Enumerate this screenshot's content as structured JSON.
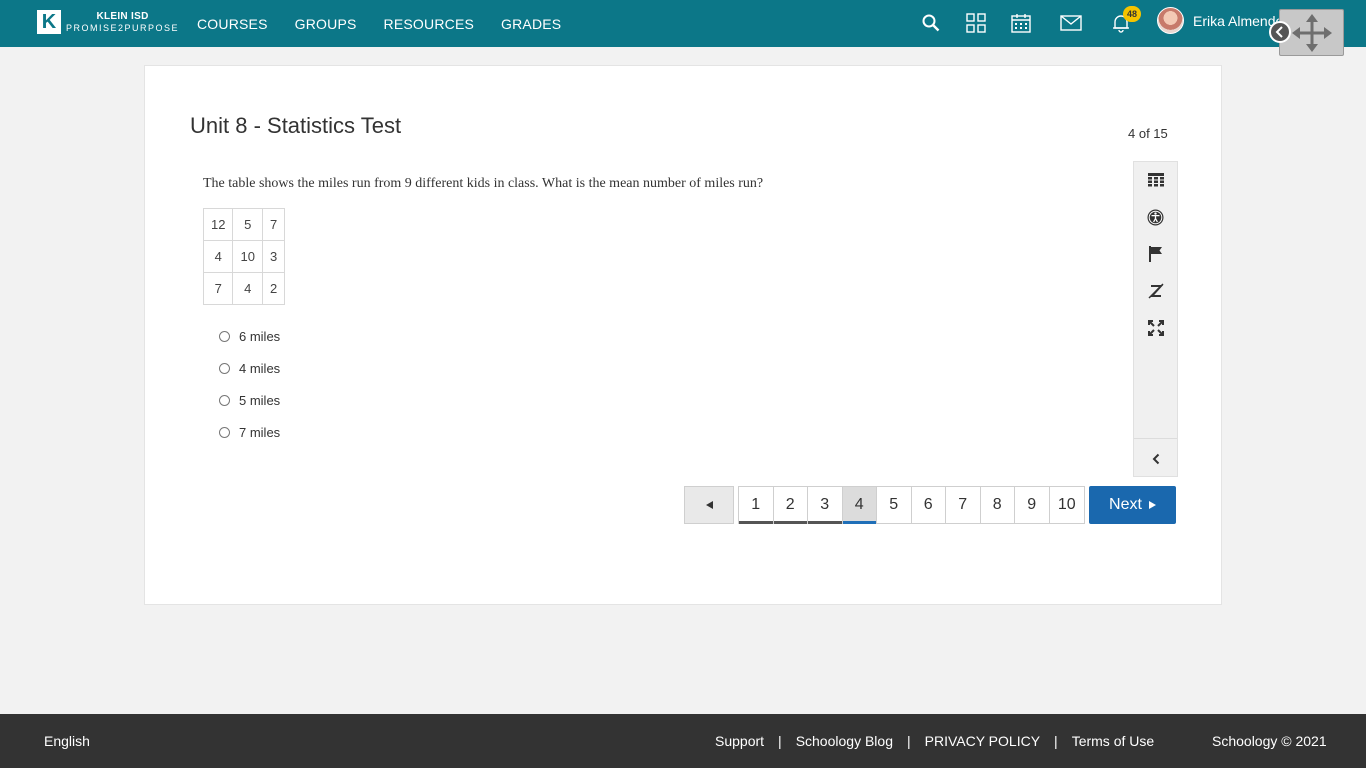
{
  "header": {
    "logo_line1": "KLEIN ISD",
    "logo_line2": "PROMISE2PURPOSE",
    "nav": [
      "COURSES",
      "GROUPS",
      "RESOURCES",
      "GRADES"
    ],
    "notification_count": "48",
    "user_name": "Erika Almendo",
    "icons": [
      "search-icon",
      "apps-grid-icon",
      "calendar-icon",
      "mail-icon",
      "bell-icon"
    ]
  },
  "test": {
    "title": "Unit 8 - Statistics Test",
    "counter": "4 of 15",
    "question": "The table shows the miles run from 9 different kids in class. What is the mean number of miles run?",
    "table": [
      [
        "12",
        "5",
        "7"
      ],
      [
        "4",
        "10",
        "3"
      ],
      [
        "7",
        "4",
        "2"
      ]
    ],
    "choices": [
      "6 miles",
      "4 miles",
      "5 miles",
      "7 miles"
    ]
  },
  "tools": [
    "calculator-icon",
    "accessibility-icon",
    "flag-icon",
    "eraser-icon",
    "fullscreen-icon",
    "collapse-icon"
  ],
  "pagination": {
    "pages": [
      "1",
      "2",
      "3",
      "4",
      "5",
      "6",
      "7",
      "8",
      "9",
      "10"
    ],
    "current": "4",
    "next_label": "Next"
  },
  "footer": {
    "language": "English",
    "links": [
      "Support",
      "Schoology Blog",
      "PRIVACY POLICY",
      "Terms of Use"
    ],
    "separator": "|",
    "copyright": "Schoology © 2021"
  },
  "colors": {
    "header_bg": "#0c7788",
    "next_btn": "#1a68ae",
    "footer_bg": "#333333",
    "badge": "#f5c400"
  }
}
